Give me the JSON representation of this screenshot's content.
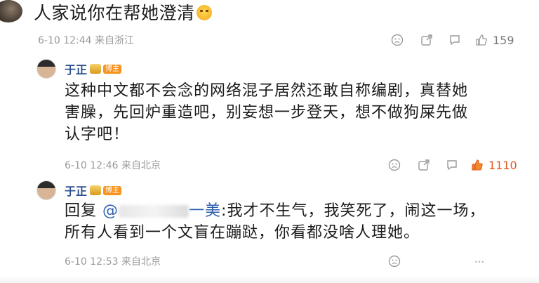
{
  "top_comment": {
    "text": "人家说你在帮她澄清",
    "emoji": "laughing-emoji",
    "timestamp": "6-10 12:44",
    "location": "来自浙江",
    "like_count": "159"
  },
  "replies": [
    {
      "author": "于正",
      "badge": "博主",
      "text": "这种中文都不会念的网络混子居然还敢自称编剧，真替她害臊，先回炉重造吧，别妄想一步登天，想不做狗屎先做认字吧！",
      "line1": "这种中文都不会念的网络混子居然还敢自称编剧，真替她",
      "line2": "害臊，先回炉重造吧，别妄想一步登天，想不做狗屎先做",
      "line3": "认字吧！",
      "timestamp": "6-10 12:46",
      "location": "来自北京",
      "like_count": "1110"
    },
    {
      "author": "于正",
      "badge": "博主",
      "reply_prefix": "回复",
      "mention": "@",
      "mention_tail": "一美",
      "line1_rest": ":我才不生气，我笑死了，闹这一场，",
      "line2": "所有人看到一个文盲在蹦跶，你看都没啥人理她。",
      "timestamp": "6-10 12:53",
      "location": "来自北京",
      "watermark": "•••"
    }
  ],
  "colors": {
    "accent_name": "#2d4f8f",
    "hot_like": "#e05a1e",
    "badge": "#f7931e"
  }
}
